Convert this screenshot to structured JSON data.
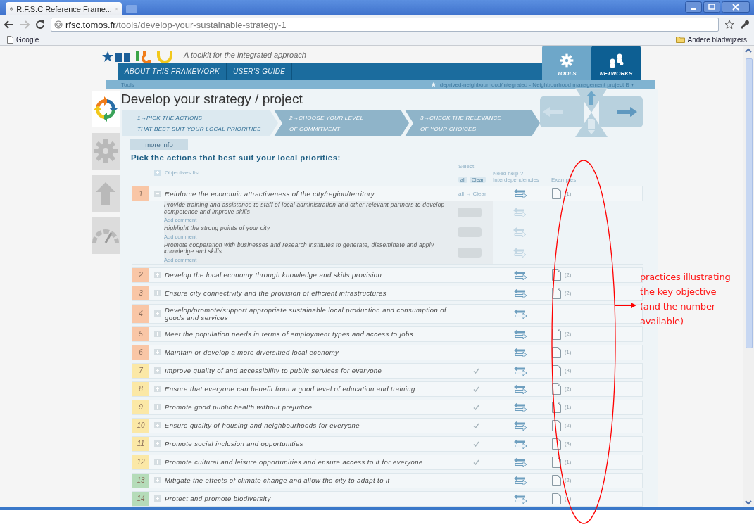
{
  "browser": {
    "tab_title": "R.F.S.C Reference Frame...",
    "url_host": "rfsc.tomos.fr",
    "url_path": "/tools/develop-your-sustainable-strategy-1",
    "bookmark": "Google",
    "other_bookmarks": "Andere bladwijzers"
  },
  "site": {
    "tagline": "A toolkit for the integrated approach",
    "nav": [
      "ABOUT THIS FRAMEWORK",
      "USER'S GUIDE"
    ],
    "tabs": [
      {
        "label": "TOOLS",
        "kind": "gear",
        "selected": true
      },
      {
        "label": "NETWORKS",
        "kind": "people",
        "selected": false
      }
    ],
    "breadcrumb": "Tools",
    "project": "deprived-neighbourhood/integrated - Neighbourhood management project B ▾"
  },
  "sidebar": [
    {
      "kind": "cycle",
      "selected": true
    },
    {
      "kind": "gear",
      "selected": false
    },
    {
      "kind": "arrows",
      "selected": false
    },
    {
      "kind": "gauge",
      "selected": false
    }
  ],
  "page": {
    "title": "Develop your strategy / project",
    "steps": [
      {
        "title": "1→PICK THE ACTIONS",
        "subtitle": "THAT BEST SUIT YOUR LOCAL PRIORITIES",
        "selected": true
      },
      {
        "title": "2→CHOOSE YOUR LEVEL",
        "subtitle": "OF COMMITMENT",
        "selected": false
      },
      {
        "title": "3→CHECK THE RELEVANCE",
        "subtitle": "OF YOUR CHOICES",
        "selected": false
      }
    ],
    "more_info": "more info",
    "heading": "Pick the actions that best suit your local priorities:"
  },
  "table": {
    "objectives_list": "Objectives list",
    "select_label": "Select",
    "select_all": "all",
    "select_clear": "Clear",
    "help_label": "Need help ?",
    "col_interdependencies": "Interdependencies",
    "col_examples": "Examples",
    "rows": [
      {
        "number": "1",
        "title": "Reinforce the economic attractiveness of the city/region/territory",
        "color": "#f9c6a6",
        "expanded": true,
        "checked": false,
        "select_text": "all → Clear",
        "examples": "(1)",
        "actions": [
          {
            "text": "Provide training and assistance to staff of local administration and other relevant partners to develop competence and improve skills",
            "comment": "Add comment",
            "selected": false
          },
          {
            "text": "Highlight the strong points of your city",
            "comment": "Add comment",
            "selected": false
          },
          {
            "text": "Promote cooperation with businesses and research institutes to generate, disseminate and apply knowledge and skills",
            "comment": "Add comment",
            "selected": false
          }
        ]
      },
      {
        "number": "2",
        "title": "Develop the local economy through knowledge and skills provision",
        "color": "#f9c6a6",
        "expanded": false,
        "checked": false,
        "examples": "(2)"
      },
      {
        "number": "3",
        "title": "Ensure city connectivity and the provision of efficient infrastructures",
        "color": "#f9c6a6",
        "expanded": false,
        "checked": false,
        "examples": "(2)"
      },
      {
        "number": "4",
        "title": "Develop/promote/support appropriate sustainable local production and consumption of goods and services",
        "color": "#f9c6a6",
        "expanded": false,
        "checked": false
      },
      {
        "number": "5",
        "title": "Meet the population needs in terms of employment types and access to jobs",
        "color": "#f9c6a6",
        "expanded": false,
        "checked": false,
        "examples": "(2)"
      },
      {
        "number": "6",
        "title": "Maintain or develop a more diversified local economy",
        "color": "#f9c6a6",
        "expanded": false,
        "checked": false,
        "examples": "(1)"
      },
      {
        "number": "7",
        "title": "Improve quality of and accessibility to public services for everyone",
        "color": "#fbe8a6",
        "expanded": false,
        "checked": true,
        "examples": "(3)"
      },
      {
        "number": "8",
        "title": "Ensure that everyone can benefit from a good level of education and training",
        "color": "#fbe8a6",
        "expanded": false,
        "checked": true,
        "examples": "(2)"
      },
      {
        "number": "9",
        "title": "Promote good public health without prejudice",
        "color": "#fbe8a6",
        "expanded": false,
        "checked": true,
        "examples": "(1)"
      },
      {
        "number": "10",
        "title": "Ensure quality of housing and neighbourhoods for everyone",
        "color": "#fbe8a6",
        "expanded": false,
        "checked": true,
        "examples": "(2)"
      },
      {
        "number": "11",
        "title": "Promote social inclusion and opportunities",
        "color": "#fbe8a6",
        "expanded": false,
        "checked": true,
        "examples": "(3)"
      },
      {
        "number": "12",
        "title": "Promote cultural and leisure opportunities and ensure access to it for everyone",
        "color": "#fbe8a6",
        "expanded": false,
        "checked": true,
        "examples": "(1)"
      },
      {
        "number": "13",
        "title": "Mitigate the effects of climate change and allow the city to adapt to it",
        "color": "#b5dcb9",
        "expanded": false,
        "checked": false,
        "examples": "(2)"
      },
      {
        "number": "14",
        "title": "Protect and promote biodiversity",
        "color": "#b5dcb9",
        "expanded": false,
        "checked": false,
        "examples": "(1)"
      }
    ]
  },
  "annotation": {
    "note": "practices illustrating the key objective",
    "note_detail": "(and the number available)"
  }
}
